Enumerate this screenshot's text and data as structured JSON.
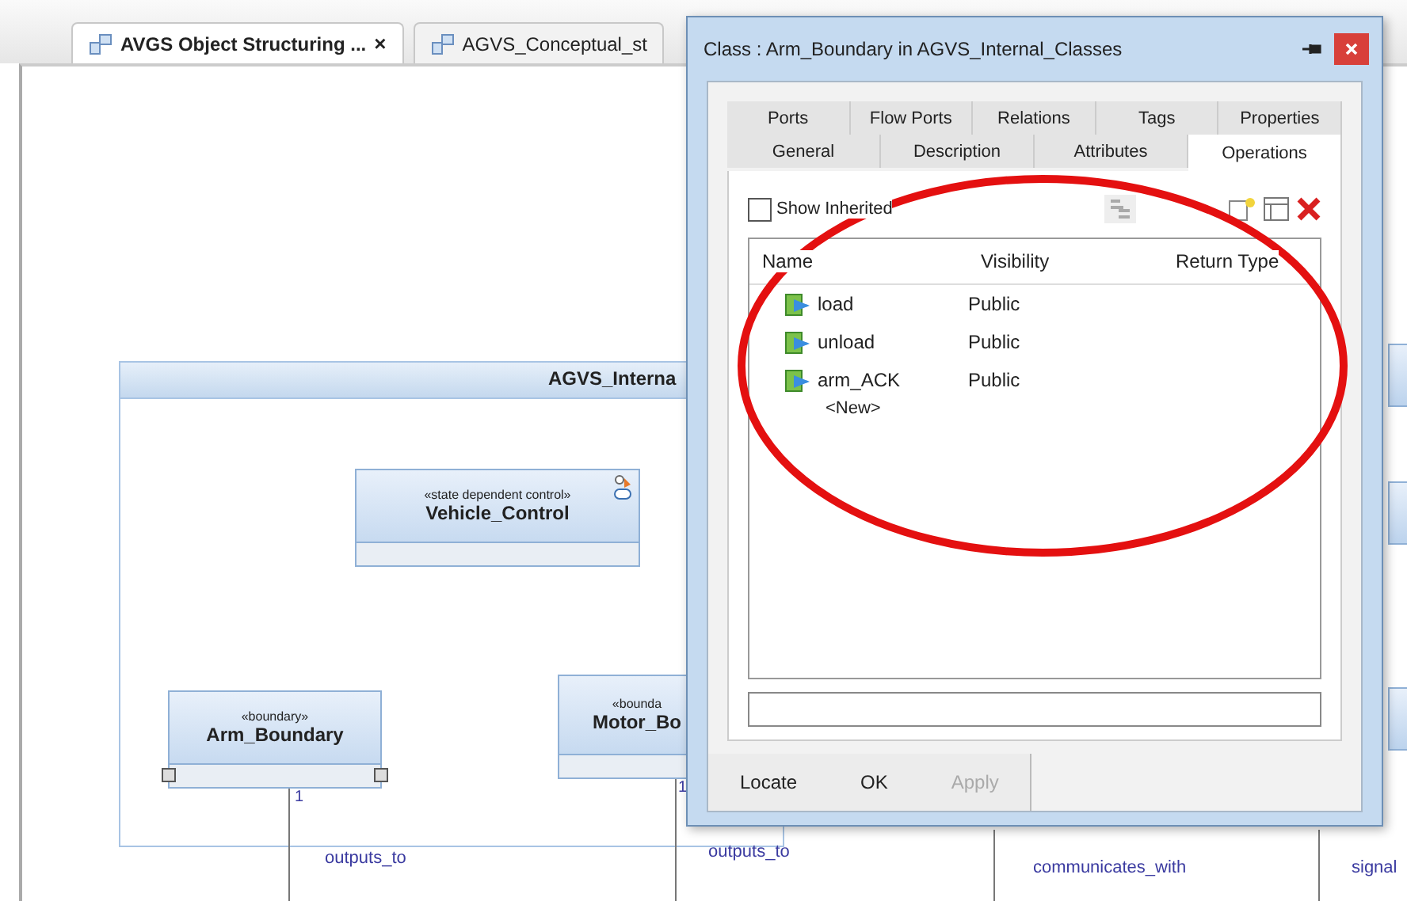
{
  "editor_tabs": [
    {
      "label": "AVGS Object Structuring ...",
      "close": "×",
      "selected": true
    },
    {
      "label": "AGVS_Conceptual_st",
      "selected": false
    }
  ],
  "diagram": {
    "package": {
      "title": "AGVS_Interna"
    },
    "classes": [
      {
        "stereotype": "«state dependent control»",
        "name": "Vehicle_Control",
        "kind": "active"
      },
      {
        "stereotype": "«boundary»",
        "name": "Arm_Boundary",
        "kind": "ports"
      },
      {
        "stereotype": "«bounda",
        "name": "Motor_Bo",
        "kind": "plain"
      }
    ],
    "links": [
      {
        "multiplicity": "1",
        "label": "outputs_to"
      },
      {
        "multiplicity": "1",
        "label": "outputs_to"
      },
      {
        "label": "communicates_with"
      },
      {
        "label": "signal"
      }
    ]
  },
  "dialog": {
    "title": "Class : Arm_Boundary in AGVS_Internal_Classes",
    "tab_rows": [
      [
        {
          "label": "Ports",
          "selected": false
        },
        {
          "label": "Flow Ports",
          "selected": false
        },
        {
          "label": "Relations",
          "selected": false
        },
        {
          "label": "Tags",
          "selected": false
        },
        {
          "label": "Properties",
          "selected": false
        }
      ],
      [
        {
          "label": "General",
          "selected": false
        },
        {
          "label": "Description",
          "selected": false
        },
        {
          "label": "Attributes",
          "selected": false
        },
        {
          "label": "Operations",
          "selected": true
        }
      ]
    ],
    "show_inherited": {
      "label": "Show Inherited",
      "checked": false
    },
    "columns": [
      "Name",
      "Visibility",
      "Return Type"
    ],
    "operations": [
      {
        "name": "load",
        "visibility": "Public"
      },
      {
        "name": "unload",
        "visibility": "Public"
      },
      {
        "name": "arm_ACK",
        "visibility": "Public"
      }
    ],
    "new_row": "<New>",
    "buttons": [
      {
        "label": "Locate",
        "disabled": false
      },
      {
        "label": "OK",
        "disabled": false
      },
      {
        "label": "Apply",
        "disabled": true
      }
    ]
  }
}
